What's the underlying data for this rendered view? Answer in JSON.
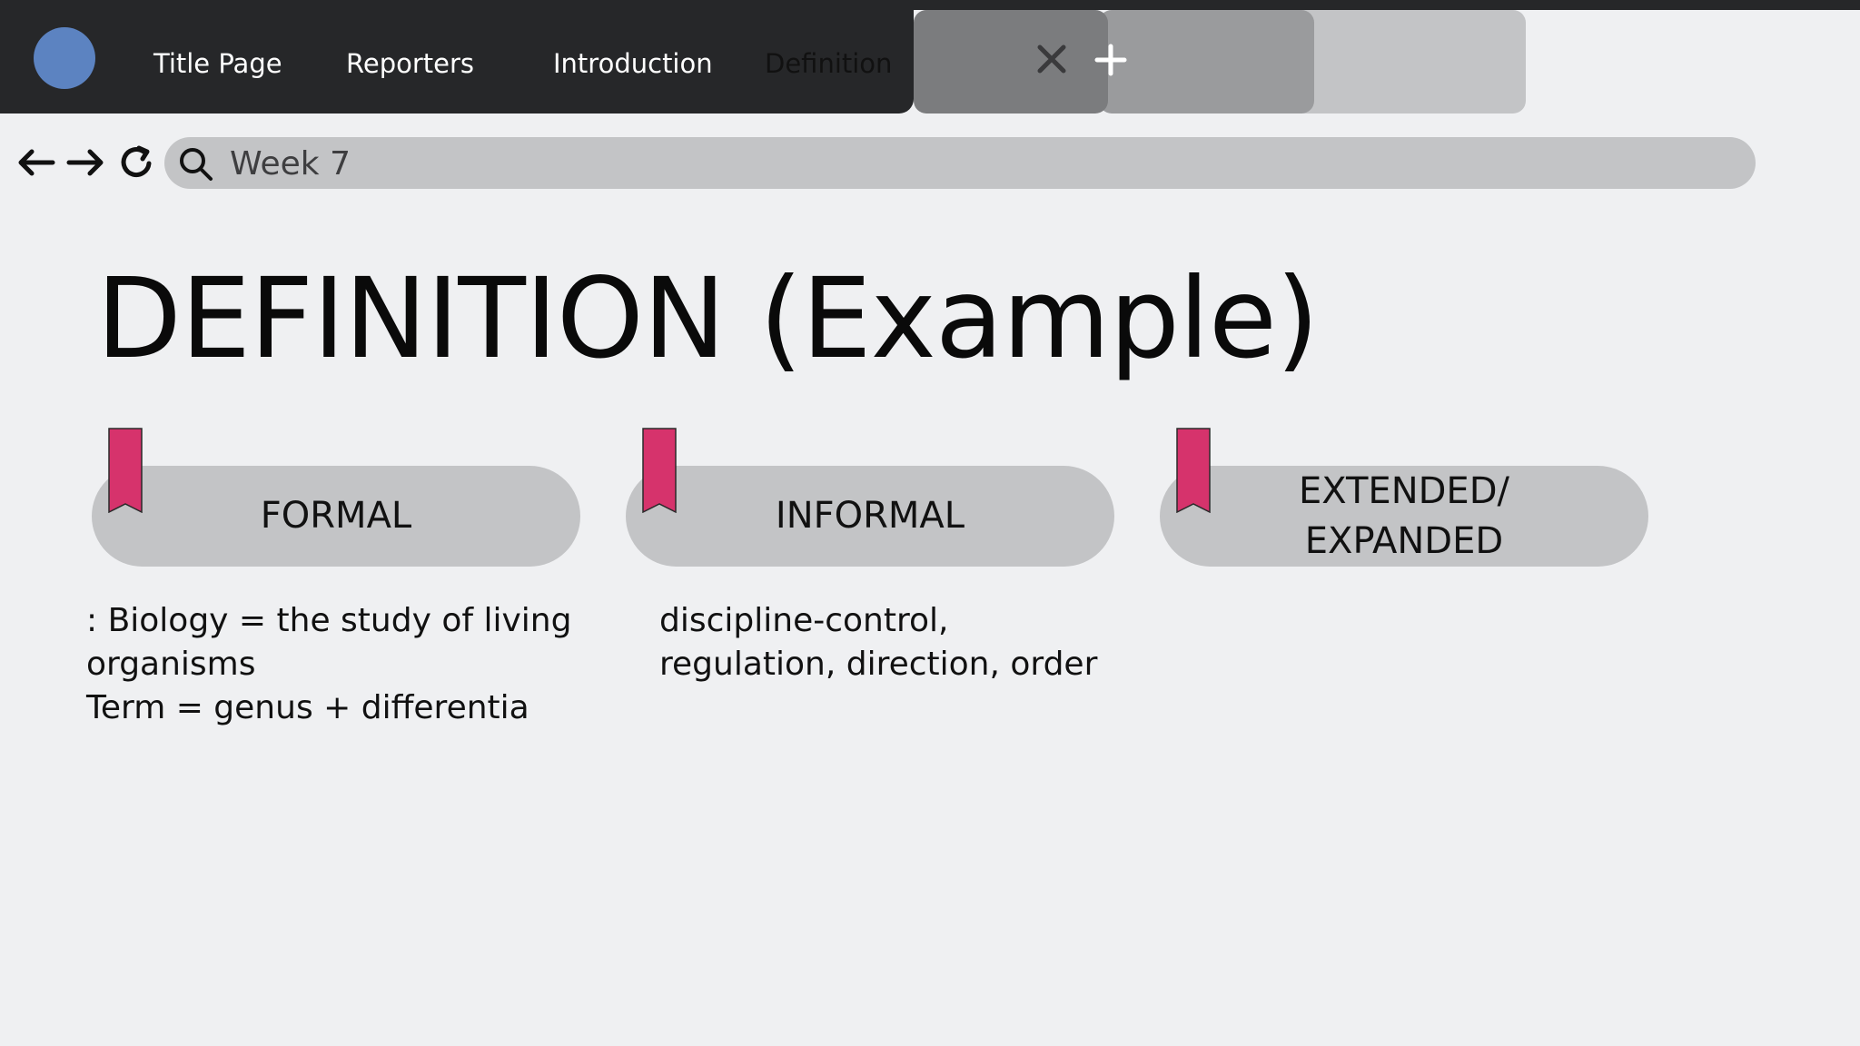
{
  "window": {
    "tabs": [
      {
        "label": "Title Page",
        "active": false
      },
      {
        "label": "Reporters",
        "active": false
      },
      {
        "label": "Introduction",
        "active": false
      },
      {
        "label": "Definition",
        "active": true
      }
    ]
  },
  "toolbar": {
    "address": "Week 7",
    "icons": [
      "back-arrow-icon",
      "forward-arrow-icon",
      "reload-icon",
      "search-icon",
      "close-icon",
      "plus-icon"
    ]
  },
  "slide": {
    "title": "DEFINITION (Example)",
    "cards": [
      {
        "label": "FORMAL",
        "body_lines": [
          ": Biology = the study of living organisms",
          "Term = genus + differentia"
        ]
      },
      {
        "label": "INFORMAL",
        "body_lines": [
          "discipline-control, regulation, direction, order"
        ]
      },
      {
        "label": "EXTENDED/\nEXPANDED",
        "body_lines": []
      }
    ]
  },
  "colors": {
    "titlebar": "#262729",
    "background": "#eff0f2",
    "pill": "#c3c4c6",
    "bookmark": "#d6336c",
    "logo": "#5c83c1"
  }
}
